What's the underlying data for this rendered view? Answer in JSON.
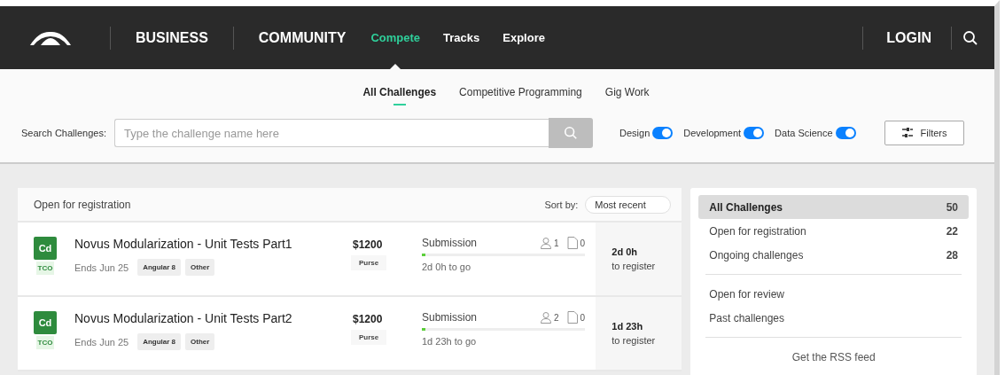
{
  "nav": {
    "primary": [
      "BUSINESS",
      "COMMUNITY"
    ],
    "secondary": [
      {
        "label": "Compete",
        "selected": true
      },
      {
        "label": "Tracks",
        "selected": false
      },
      {
        "label": "Explore",
        "selected": false
      }
    ],
    "login": "LOGIN"
  },
  "tabs": [
    {
      "label": "All Challenges",
      "selected": true
    },
    {
      "label": "Competitive Programming",
      "selected": false
    },
    {
      "label": "Gig Work",
      "selected": false
    }
  ],
  "search": {
    "label": "Search Challenges:",
    "placeholder": "Type the challenge name here"
  },
  "tracks": [
    {
      "label": "Design",
      "on": true
    },
    {
      "label": "Development",
      "on": true
    },
    {
      "label": "Data Science",
      "on": true
    }
  ],
  "filters_button": "Filters",
  "list": {
    "title": "Open for registration",
    "sort_label": "Sort by:",
    "sort_value": "Most recent",
    "rows": [
      {
        "track": "Cd",
        "event": "TCO",
        "title": "Novus Modularization - Unit Tests Part1",
        "ends": "Ends Jun 25",
        "tags": [
          "Angular 8",
          "Other"
        ],
        "prize": "$1200",
        "prize_label": "Purse",
        "phase": "Submission",
        "registrants": "1",
        "submissions": "0",
        "level": 0.02,
        "phase_left": "2d 0h to go",
        "time": "2d 0h",
        "time_label": "to register"
      },
      {
        "track": "Cd",
        "event": "TCO",
        "title": "Novus Modularization - Unit Tests Part2",
        "ends": "Ends Jun 25",
        "tags": [
          "Angular 8",
          "Other"
        ],
        "prize": "$1200",
        "prize_label": "Purse",
        "phase": "Submission",
        "registrants": "2",
        "submissions": "0",
        "level": 0.02,
        "phase_left": "1d 23h to go",
        "time": "1d 23h",
        "time_label": "to register"
      }
    ]
  },
  "sidebar": {
    "groups": [
      [
        {
          "label": "All Challenges",
          "count": "50",
          "selected": true
        },
        {
          "label": "Open for registration",
          "count": "22",
          "selected": false
        },
        {
          "label": "Ongoing challenges",
          "count": "28",
          "selected": false
        }
      ],
      [
        {
          "label": "Open for review",
          "selected": false
        },
        {
          "label": "Past challenges",
          "selected": false
        }
      ]
    ],
    "rss": "Get the RSS feed"
  }
}
